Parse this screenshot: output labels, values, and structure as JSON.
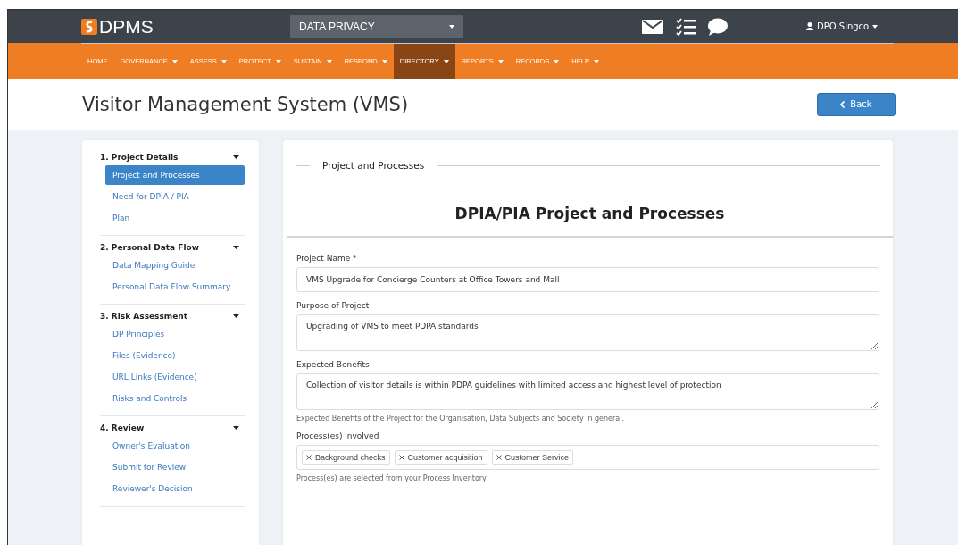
{
  "header": {
    "brand": "DPMS",
    "module_select": {
      "value": "DATA PRIVACY"
    },
    "user": "DPO Singco"
  },
  "nav": [
    {
      "label": "HOME",
      "dropdown": false,
      "selected": false
    },
    {
      "label": "GOVERNANCE",
      "dropdown": true,
      "selected": false
    },
    {
      "label": "ASSESS",
      "dropdown": true,
      "selected": false
    },
    {
      "label": "PROTECT",
      "dropdown": true,
      "selected": false
    },
    {
      "label": "SUSTAIN",
      "dropdown": true,
      "selected": false
    },
    {
      "label": "RESPOND",
      "dropdown": true,
      "selected": false
    },
    {
      "label": "DIRECTORY",
      "dropdown": true,
      "selected": true
    },
    {
      "label": "REPORTS",
      "dropdown": true,
      "selected": false
    },
    {
      "label": "RECORDS",
      "dropdown": true,
      "selected": false
    },
    {
      "label": "HELP",
      "dropdown": true,
      "selected": false
    }
  ],
  "page_title": "Visitor Management System (VMS)",
  "back_button": "Back",
  "sidebar": [
    {
      "title": "1. Project Details",
      "items": [
        {
          "label": "Project and Processes",
          "selected": true
        },
        {
          "label": "Need for DPIA / PIA",
          "selected": false
        },
        {
          "label": "Plan",
          "selected": false
        }
      ]
    },
    {
      "title": "2. Personal Data Flow",
      "items": [
        {
          "label": "Data Mapping Guide",
          "selected": false
        },
        {
          "label": "Personal Data Flow Summary",
          "selected": false
        }
      ]
    },
    {
      "title": "3. Risk Assessment",
      "items": [
        {
          "label": "DP Principles",
          "selected": false
        },
        {
          "label": "Files (Evidence)",
          "selected": false
        },
        {
          "label": "URL Links (Evidence)",
          "selected": false
        },
        {
          "label": "Risks and Controls",
          "selected": false
        }
      ]
    },
    {
      "title": "4. Review",
      "items": [
        {
          "label": "Owner's Evaluation",
          "selected": false
        },
        {
          "label": "Submit for Review",
          "selected": false
        },
        {
          "label": "Reviewer's Decision",
          "selected": false
        }
      ]
    }
  ],
  "main": {
    "section": "Project and Processes",
    "heading": "DPIA/PIA Project and Processes",
    "fields": [
      {
        "kind": "input",
        "label": "Project Name *",
        "value": "VMS Upgrade for Concierge Counters at Office Towers and Mall"
      },
      {
        "kind": "textarea",
        "label": "Purpose of Project",
        "value": "Upgrading of VMS to meet PDPA standards"
      },
      {
        "kind": "textarea",
        "label": "Expected Benefits",
        "value": "Collection of visitor details is within PDPA guidelines with limited access and highest level of protection",
        "help": "Expected Benefits of the Project for the Organisation, Data Subjects and Society in general."
      },
      {
        "kind": "tags",
        "label": "Process(es) involved",
        "tags": [
          "Background checks",
          "Customer acquisition",
          "Customer Service"
        ],
        "help": "Process(es) are selected from your Process Inventory"
      }
    ]
  }
}
